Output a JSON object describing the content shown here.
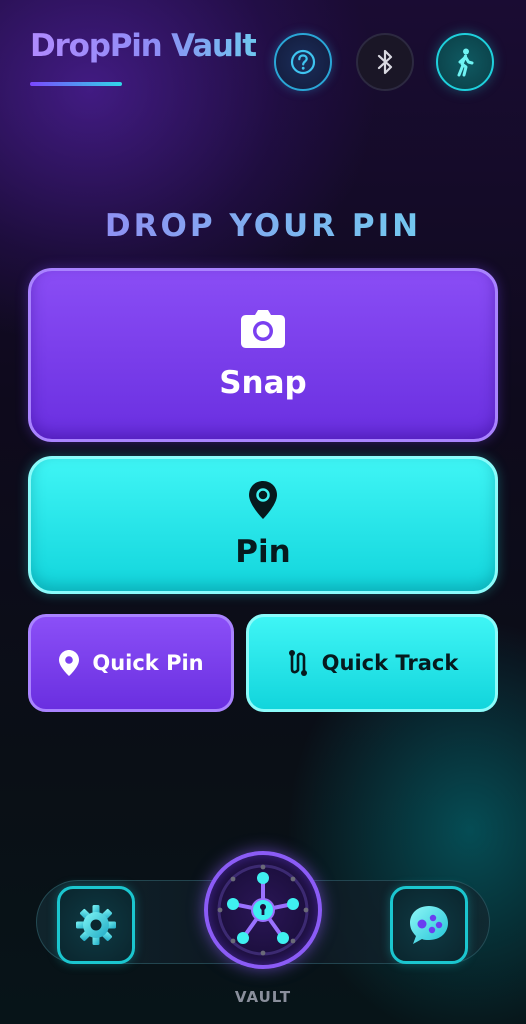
{
  "header": {
    "title": "DropPin Vault",
    "help_icon": "question-circle-icon",
    "bluetooth_icon": "bluetooth-icon",
    "walk_icon": "walking-person-icon"
  },
  "section_title": "DROP YOUR PIN",
  "actions": {
    "snap": {
      "label": "Snap",
      "icon": "camera-icon"
    },
    "pin": {
      "label": "Pin",
      "icon": "map-pin-icon"
    },
    "quick_pin": {
      "label": "Quick Pin",
      "icon": "location-pin-icon"
    },
    "quick_track": {
      "label": "Quick Track",
      "icon": "route-icon"
    }
  },
  "bottom_nav": {
    "settings_icon": "gear-icon",
    "vault_label": "VAULT",
    "vault_icon": "vault-wheel-icon",
    "games_icon": "gamepad-bubble-icon"
  },
  "colors": {
    "purple": "#7b3ff0",
    "cyan": "#22e0e6",
    "background": "#0e0a1c"
  }
}
